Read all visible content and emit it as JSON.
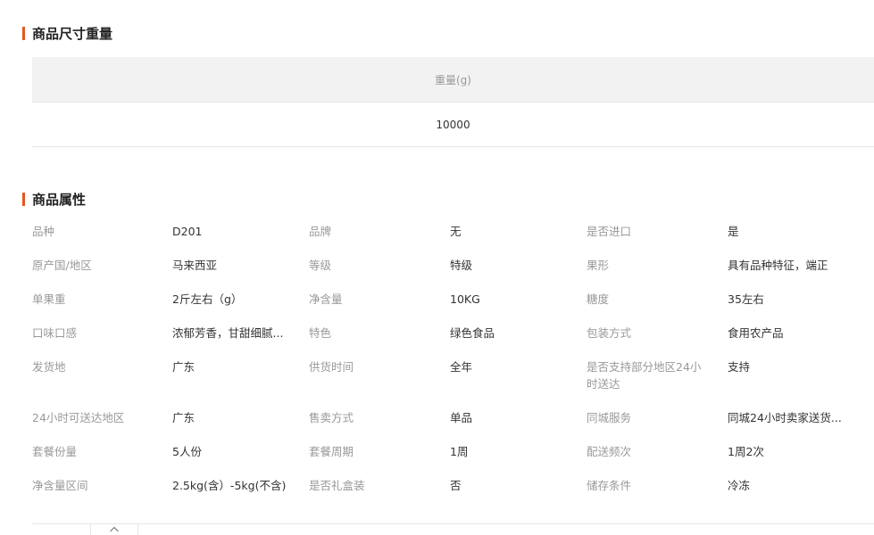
{
  "size_section": {
    "title": "商品尺寸重量",
    "header": "重量(g)",
    "value": "10000"
  },
  "attr_section": {
    "title": "商品属性",
    "rows": [
      [
        [
          "品种",
          "D201"
        ],
        [
          "品牌",
          "无"
        ],
        [
          "是否进口",
          "是"
        ]
      ],
      [
        [
          "原产国/地区",
          "马来西亚"
        ],
        [
          "等级",
          "特级"
        ],
        [
          "果形",
          "具有品种特征，端正"
        ]
      ],
      [
        [
          "单果重",
          "2斤左右（g）"
        ],
        [
          "净含量",
          "10KG"
        ],
        [
          "糖度",
          "35左右"
        ]
      ],
      [
        [
          "口味口感",
          "浓郁芳香，甘甜细腻..."
        ],
        [
          "特色",
          "绿色食品"
        ],
        [
          "包装方式",
          "食用农产品"
        ]
      ],
      [
        [
          "发货地",
          "广东"
        ],
        [
          "供货时间",
          "全年"
        ],
        [
          "是否支持部分地区24小时送达",
          "支持"
        ]
      ],
      [
        [
          "24小时可送达地区",
          "广东"
        ],
        [
          "售卖方式",
          "单品"
        ],
        [
          "同城服务",
          "同城24小时卖家送货..."
        ]
      ],
      [
        [
          "套餐份量",
          "5人份"
        ],
        [
          "套餐周期",
          "1周"
        ],
        [
          "配送频次",
          "1周2次"
        ]
      ],
      [
        [
          "净含量区间",
          "2.5kg(含）-5kg(不含)"
        ],
        [
          "是否礼盒装",
          "否"
        ],
        [
          "储存条件",
          "冷冻"
        ]
      ]
    ]
  },
  "colors": {
    "accent": "#e4561f",
    "label": "#999999",
    "value": "#333333",
    "header_bg": "#f2f2f2"
  },
  "icons": {
    "scroll_up": "chevron-up-icon"
  }
}
